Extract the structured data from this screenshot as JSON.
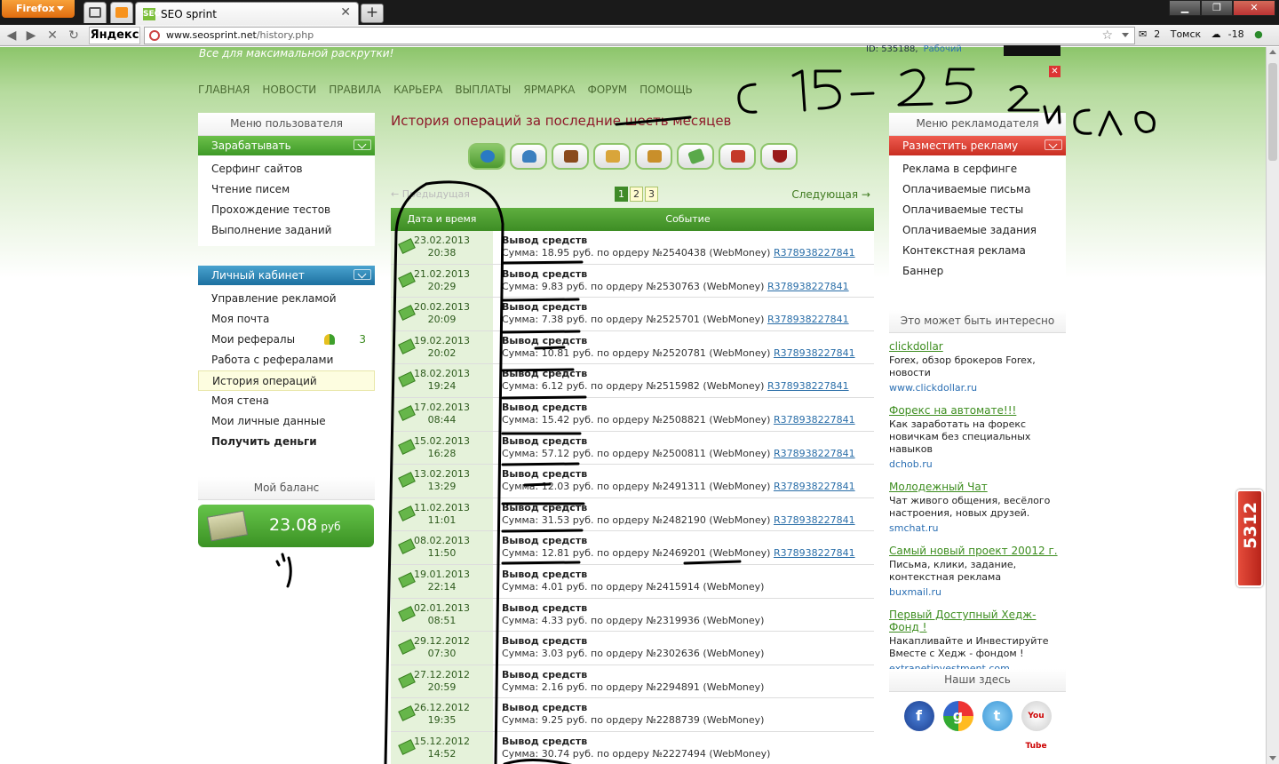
{
  "browser": {
    "app_button": "Firefox",
    "tab_title": "SEO sprint",
    "tab_favicon": "SEO",
    "url_host": "www.seosprint.net",
    "url_path": "/history.php",
    "yandex": "Яндекс",
    "mail_count": "2",
    "city": "Томск",
    "temperature": "-18"
  },
  "header": {
    "slogan": "Все для максимальной раскрутки!",
    "user_id": "ID: 535188,",
    "user_status": "Рабочий",
    "nav": [
      "ГЛАВНАЯ",
      "НОВОСТИ",
      "ПРАВИЛА",
      "КАРЬЕРА",
      "ВЫПЛАТЫ",
      "ЯРМАРКА",
      "ФОРУМ",
      "ПОМОЩЬ"
    ]
  },
  "left": {
    "user_menu_title": "Меню пользователя",
    "earn_title": "Зарабатывать",
    "earn_items": [
      "Серфинг сайтов",
      "Чтение писем",
      "Прохождение тестов",
      "Выполнение заданий"
    ],
    "cabinet_title": "Личный кабинет",
    "cabinet_items": [
      "Управление рекламой",
      "Моя почта",
      "Мои рефералы",
      "Работа с рефералами",
      "История операций",
      "Моя стена",
      "Мои личные данные",
      "Получить деньги"
    ],
    "referrals_count": "3",
    "balance_title": "Мой баланс",
    "balance_amount": "23.08",
    "balance_currency": "руб"
  },
  "main": {
    "title": "История операций за последние шесть месяцев",
    "icons": [
      "globe-icon",
      "user-icon",
      "wallet-icon",
      "document-icon",
      "bag-icon",
      "money-icon",
      "tools-icon",
      "glass-icon"
    ],
    "prev": "← Предыдущая",
    "pages": [
      "1",
      "2",
      "3"
    ],
    "next": "Следующая →",
    "col_date": "Дата и время",
    "col_event": "Событие",
    "rows": [
      {
        "date": "23.02.2013",
        "time": "20:38",
        "title": "Вывод средств",
        "sum": "18.95",
        "order": "2540438",
        "wallet": "R378938227841"
      },
      {
        "date": "21.02.2013",
        "time": "20:29",
        "title": "Вывод средств",
        "sum": "9.83",
        "order": "2530763",
        "wallet": "R378938227841"
      },
      {
        "date": "20.02.2013",
        "time": "20:09",
        "title": "Вывод средств",
        "sum": "7.38",
        "order": "2525701",
        "wallet": "R378938227841"
      },
      {
        "date": "19.02.2013",
        "time": "20:02",
        "title": "Вывод средств",
        "sum": "10.81",
        "order": "2520781",
        "wallet": "R378938227841"
      },
      {
        "date": "18.02.2013",
        "time": "19:24",
        "title": "Вывод средств",
        "sum": "6.12",
        "order": "2515982",
        "wallet": "R378938227841"
      },
      {
        "date": "17.02.2013",
        "time": "08:44",
        "title": "Вывод средств",
        "sum": "15.42",
        "order": "2508821",
        "wallet": "R378938227841"
      },
      {
        "date": "15.02.2013",
        "time": "16:28",
        "title": "Вывод средств",
        "sum": "57.12",
        "order": "2500811",
        "wallet": "R378938227841"
      },
      {
        "date": "13.02.2013",
        "time": "13:29",
        "title": "Вывод средств",
        "sum": "12.03",
        "order": "2491311",
        "wallet": "R378938227841"
      },
      {
        "date": "11.02.2013",
        "time": "11:01",
        "title": "Вывод средств",
        "sum": "31.53",
        "order": "2482190",
        "wallet": "R378938227841"
      },
      {
        "date": "08.02.2013",
        "time": "11:50",
        "title": "Вывод средств",
        "sum": "12.81",
        "order": "2469201",
        "wallet": "R378938227841"
      },
      {
        "date": "19.01.2013",
        "time": "22:14",
        "title": "Вывод средств",
        "sum": "4.01",
        "order": "2415914",
        "wallet": ""
      },
      {
        "date": "02.01.2013",
        "time": "08:51",
        "title": "Вывод средств",
        "sum": "4.33",
        "order": "2319936",
        "wallet": ""
      },
      {
        "date": "29.12.2012",
        "time": "07:30",
        "title": "Вывод средств",
        "sum": "3.03",
        "order": "2302636",
        "wallet": ""
      },
      {
        "date": "27.12.2012",
        "time": "20:59",
        "title": "Вывод средств",
        "sum": "2.16",
        "order": "2294891",
        "wallet": ""
      },
      {
        "date": "26.12.2012",
        "time": "19:35",
        "title": "Вывод средств",
        "sum": "9.25",
        "order": "2288739",
        "wallet": ""
      },
      {
        "date": "15.12.2012",
        "time": "14:52",
        "title": "Вывод средств",
        "sum": "30.74",
        "order": "2227494",
        "wallet": ""
      }
    ]
  },
  "right": {
    "adv_menu_title": "Меню рекламодателя",
    "place_ad": "Разместить рекламу",
    "adv_items": [
      "Реклама в серфинге",
      "Оплачиваемые письма",
      "Оплачиваемые тесты",
      "Оплачиваемые задания",
      "Контекстная реклама",
      "Баннер"
    ],
    "interest_title": "Это может быть интересно",
    "ads": [
      {
        "title": "clickdollar",
        "desc": "Forex, обзор брокеров Forex, новости",
        "url": "www.clickdollar.ru"
      },
      {
        "title": "Форекс на автомате!!!",
        "desc": "Как заработать на форекс новичкам без специальных навыков",
        "url": "dchob.ru"
      },
      {
        "title": "Молодежный Чат",
        "desc": "Чат живого общения, весёлого настроения, новых друзей.",
        "url": "smchat.ru"
      },
      {
        "title": "Самый новый проект 20012 г.",
        "desc": "Письма, клики, задание, контекстная реклама",
        "url": "buxmail.ru"
      },
      {
        "title": "Первый Доступный Хедж-Фонд !",
        "desc": "Накапливайте и Инвестируйте Вместе с Хедж - фондом !",
        "url": "extranetinvestment.com"
      }
    ],
    "social_title": "Наши здесь",
    "social": [
      "facebook-icon",
      "google-icon",
      "twitter-icon",
      "youtube-icon"
    ],
    "social_glyphs": [
      "f",
      "g",
      "t",
      "You Tube"
    ]
  },
  "widget_number": "5312",
  "handwriting": "с 15 - 25 число",
  "colors": {
    "accent_green": "#3f9a28",
    "title_red": "#8e1a2a",
    "link_blue": "#2b6fb3"
  }
}
